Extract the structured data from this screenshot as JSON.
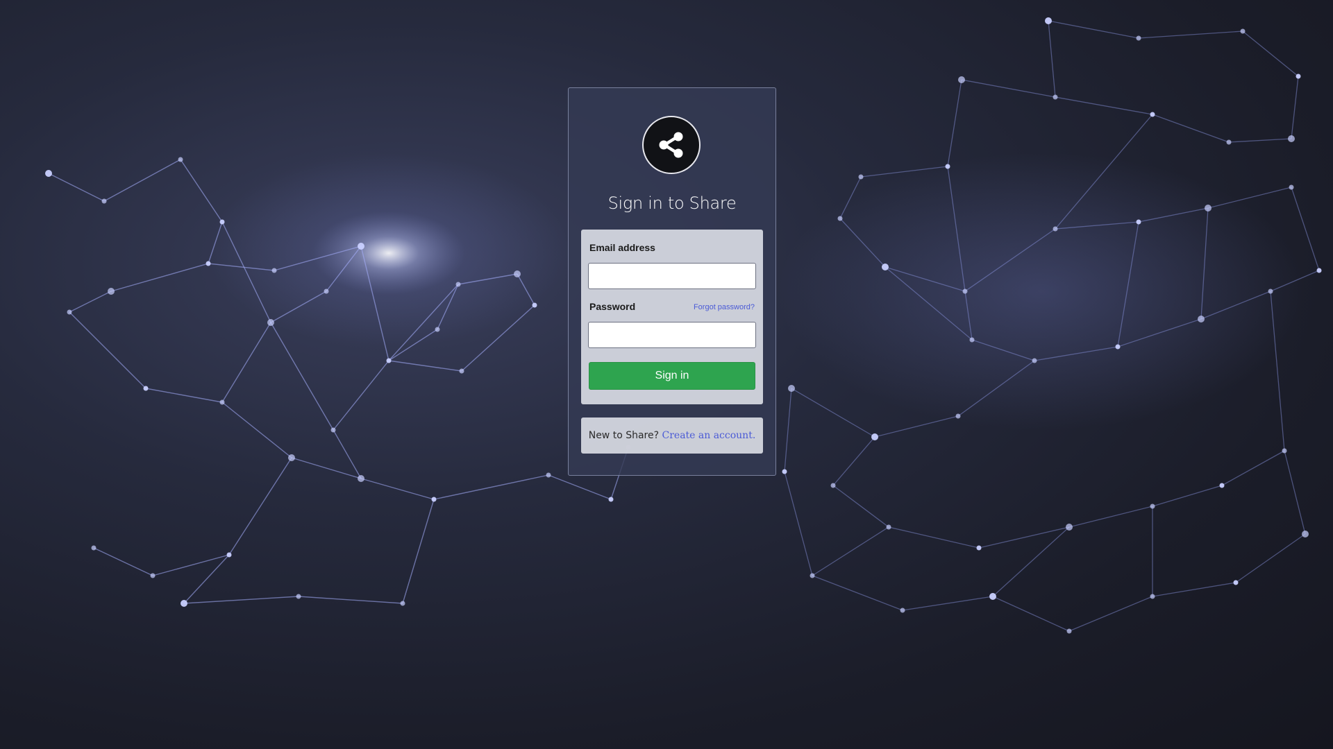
{
  "app": {
    "name": "Share"
  },
  "login": {
    "title": "Sign in to Share",
    "email_label": "Email address",
    "email_value": "",
    "password_label": "Password",
    "password_value": "",
    "forgot_password_link": "Forgot password?",
    "sign_in_button": "Sign in",
    "new_user_prompt": "New to Share?",
    "create_account_link": "Create an account."
  },
  "icons": {
    "logo": "share-icon"
  },
  "colors": {
    "accent_green": "#2ea44f",
    "link_blue": "#4a5ad6",
    "card_background": "#343a54",
    "page_background": "#1b1d29"
  }
}
